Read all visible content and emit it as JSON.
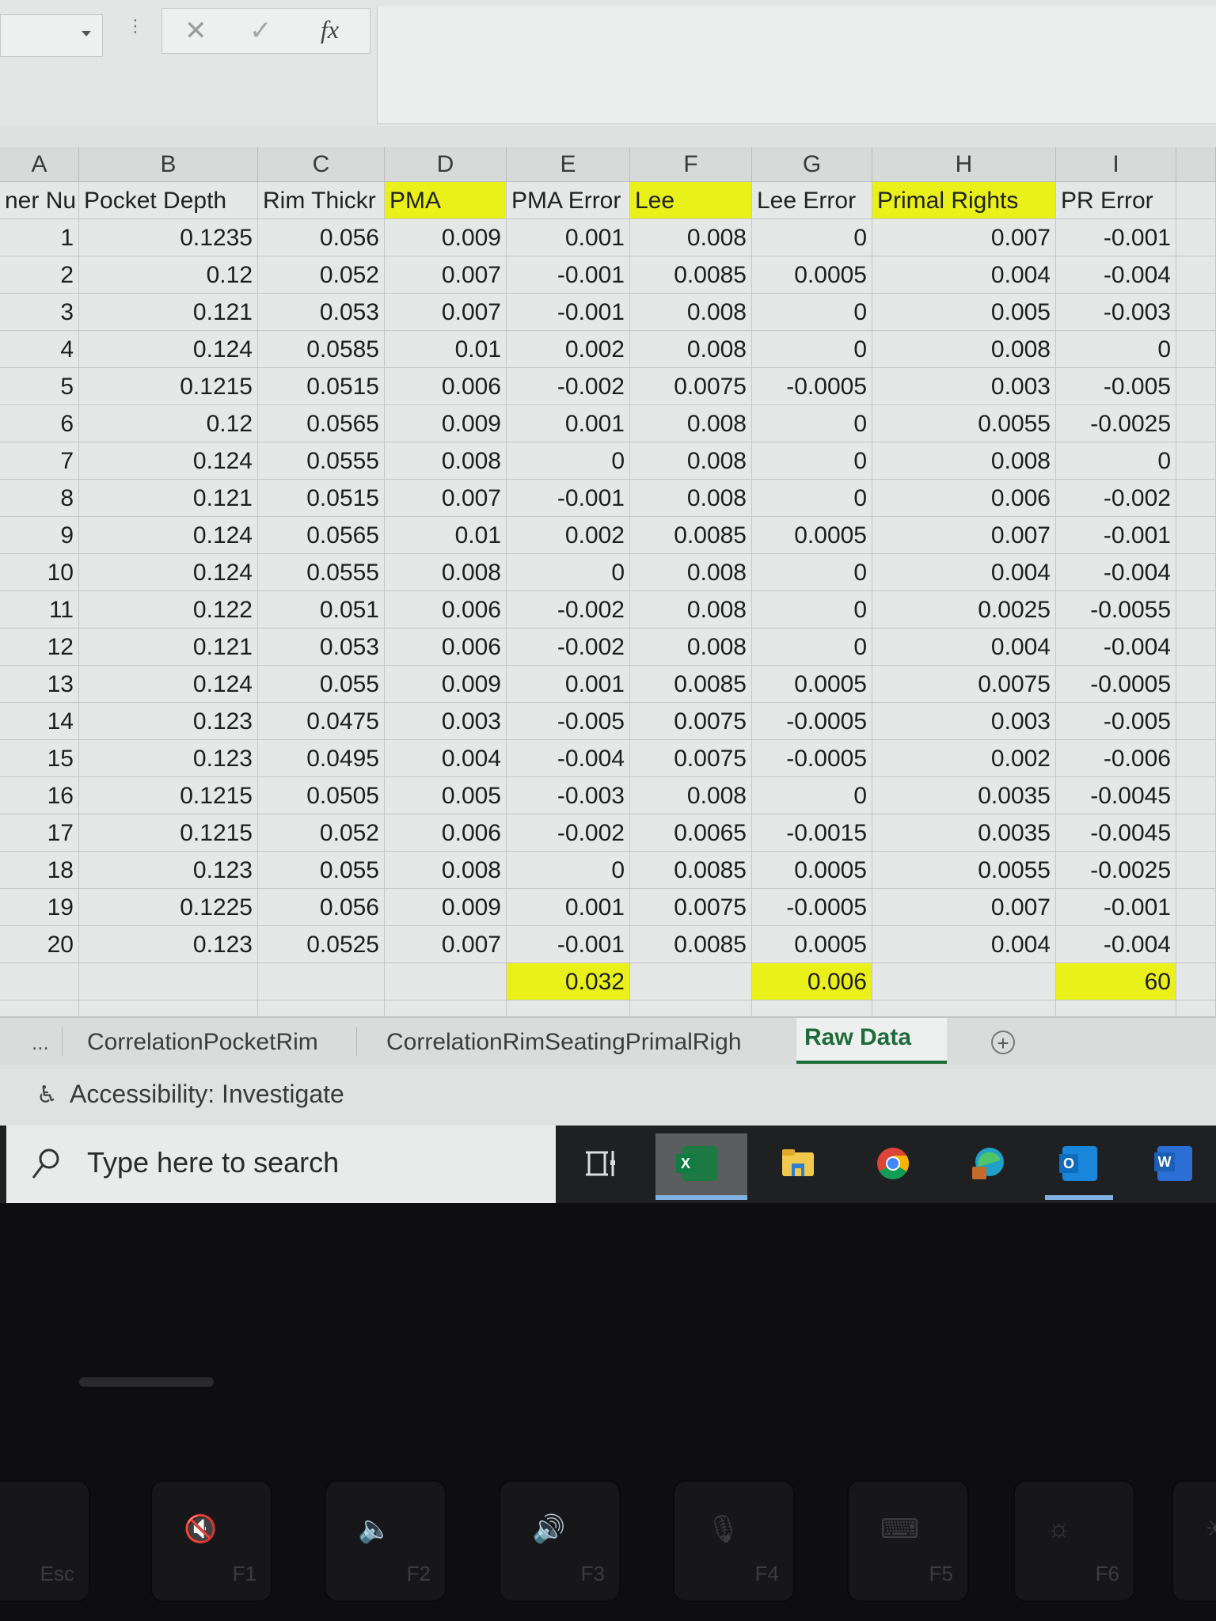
{
  "formula_bar": {
    "name_box_value": "",
    "cancel_icon": "✕",
    "enter_icon": "✓",
    "fx_label": "fx",
    "formula_value": ""
  },
  "columns": [
    "A",
    "B",
    "C",
    "D",
    "E",
    "F",
    "G",
    "H",
    "I"
  ],
  "headers": [
    "ner Nu",
    "Pocket Depth",
    "Rim Thickr",
    "PMA",
    "PMA Error",
    "Lee",
    "Lee Error",
    "Primal Rights",
    "PR Error"
  ],
  "highlighted_headers": [
    "PMA",
    "Lee",
    "Primal Rights"
  ],
  "highlight_color": "#e9f01a",
  "rows": [
    [
      "1",
      "0.1235",
      "0.056",
      "0.009",
      "0.001",
      "0.008",
      "0",
      "0.007",
      "-0.001"
    ],
    [
      "2",
      "0.12",
      "0.052",
      "0.007",
      "-0.001",
      "0.0085",
      "0.0005",
      "0.004",
      "-0.004"
    ],
    [
      "3",
      "0.121",
      "0.053",
      "0.007",
      "-0.001",
      "0.008",
      "0",
      "0.005",
      "-0.003"
    ],
    [
      "4",
      "0.124",
      "0.0585",
      "0.01",
      "0.002",
      "0.008",
      "0",
      "0.008",
      "0"
    ],
    [
      "5",
      "0.1215",
      "0.0515",
      "0.006",
      "-0.002",
      "0.0075",
      "-0.0005",
      "0.003",
      "-0.005"
    ],
    [
      "6",
      "0.12",
      "0.0565",
      "0.009",
      "0.001",
      "0.008",
      "0",
      "0.0055",
      "-0.0025"
    ],
    [
      "7",
      "0.124",
      "0.0555",
      "0.008",
      "0",
      "0.008",
      "0",
      "0.008",
      "0"
    ],
    [
      "8",
      "0.121",
      "0.0515",
      "0.007",
      "-0.001",
      "0.008",
      "0",
      "0.006",
      "-0.002"
    ],
    [
      "9",
      "0.124",
      "0.0565",
      "0.01",
      "0.002",
      "0.0085",
      "0.0005",
      "0.007",
      "-0.001"
    ],
    [
      "10",
      "0.124",
      "0.0555",
      "0.008",
      "0",
      "0.008",
      "0",
      "0.004",
      "-0.004"
    ],
    [
      "11",
      "0.122",
      "0.051",
      "0.006",
      "-0.002",
      "0.008",
      "0",
      "0.0025",
      "-0.0055"
    ],
    [
      "12",
      "0.121",
      "0.053",
      "0.006",
      "-0.002",
      "0.008",
      "0",
      "0.004",
      "-0.004"
    ],
    [
      "13",
      "0.124",
      "0.055",
      "0.009",
      "0.001",
      "0.0085",
      "0.0005",
      "0.0075",
      "-0.0005"
    ],
    [
      "14",
      "0.123",
      "0.0475",
      "0.003",
      "-0.005",
      "0.0075",
      "-0.0005",
      "0.003",
      "-0.005"
    ],
    [
      "15",
      "0.123",
      "0.0495",
      "0.004",
      "-0.004",
      "0.0075",
      "-0.0005",
      "0.002",
      "-0.006"
    ],
    [
      "16",
      "0.1215",
      "0.0505",
      "0.005",
      "-0.003",
      "0.008",
      "0",
      "0.0035",
      "-0.0045"
    ],
    [
      "17",
      "0.1215",
      "0.052",
      "0.006",
      "-0.002",
      "0.0065",
      "-0.0015",
      "0.0035",
      "-0.0045"
    ],
    [
      "18",
      "0.123",
      "0.055",
      "0.008",
      "0",
      "0.0085",
      "0.0005",
      "0.0055",
      "-0.0025"
    ],
    [
      "19",
      "0.1225",
      "0.056",
      "0.009",
      "0.001",
      "0.0075",
      "-0.0005",
      "0.007",
      "-0.001"
    ],
    [
      "20",
      "0.123",
      "0.0525",
      "0.007",
      "-0.001",
      "0.0085",
      "0.0005",
      "0.004",
      "-0.004"
    ]
  ],
  "totals": {
    "pma_error": "0.032",
    "lee_error": "0.006",
    "pr_error": "60"
  },
  "sheet_tabs": {
    "more": "...",
    "tabs": [
      "CorrelationPocketRim",
      "CorrelationRimSeatingPrimalRigh",
      "Raw Data"
    ],
    "active": "Raw Data",
    "add_label": "+"
  },
  "status_bar": {
    "accessibility": "Accessibility: Investigate"
  },
  "taskbar": {
    "search_placeholder": "Type here to search",
    "apps": [
      {
        "name": "task-view",
        "active": false
      },
      {
        "name": "excel",
        "active": true,
        "letter": "X",
        "color": "#1d7a43"
      },
      {
        "name": "file-explorer",
        "active": false,
        "color": "#f2c94c"
      },
      {
        "name": "chrome",
        "active": false
      },
      {
        "name": "edge",
        "active": false
      },
      {
        "name": "outlook",
        "active": true,
        "letter": "O",
        "color": "#0f6cbd"
      },
      {
        "name": "word",
        "active": false,
        "letter": "W",
        "color": "#1a5fb4"
      }
    ]
  },
  "keyboard": {
    "keys": [
      {
        "glyph": "",
        "label": "Esc"
      },
      {
        "glyph": "🔇",
        "label": "F1"
      },
      {
        "glyph": "🔈",
        "label": "F2"
      },
      {
        "glyph": "🔊",
        "label": "F3"
      },
      {
        "glyph": "🎙",
        "label": "F4"
      },
      {
        "glyph": "⌨",
        "label": "F5"
      },
      {
        "glyph": "☼",
        "label": "F6"
      },
      {
        "glyph": "☀",
        "label": ""
      }
    ]
  }
}
